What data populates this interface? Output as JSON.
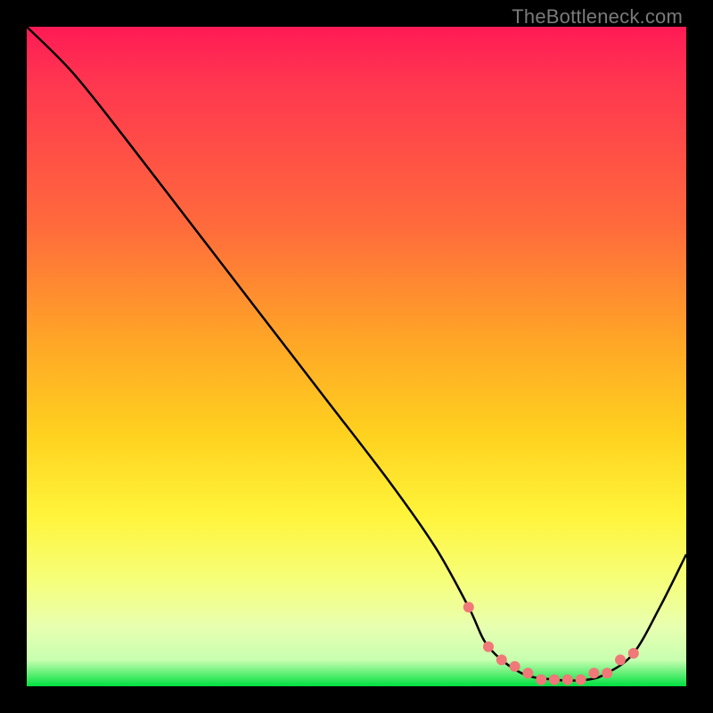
{
  "watermark": "TheBottleneck.com",
  "colors": {
    "bg": "#000000",
    "gradient_top": "#ff1a55",
    "gradient_bottom": "#00e040",
    "curve": "#000000",
    "dots": "#f07878"
  },
  "chart_data": {
    "type": "line",
    "title": "",
    "xlabel": "",
    "ylabel": "",
    "xlim": [
      0,
      100
    ],
    "ylim": [
      0,
      100
    ],
    "series": [
      {
        "name": "curve",
        "x": [
          0,
          7,
          15,
          25,
          35,
          45,
          55,
          62,
          67,
          70,
          75,
          80,
          85,
          88,
          92,
          96,
          100
        ],
        "y": [
          100,
          93,
          83,
          70,
          57,
          44,
          31,
          21,
          12,
          6,
          2,
          1,
          1,
          2,
          5,
          12,
          20
        ]
      }
    ],
    "markers": {
      "name": "dots",
      "x": [
        67,
        70,
        72,
        74,
        76,
        78,
        80,
        82,
        84,
        86,
        88,
        90,
        92
      ],
      "y": [
        12,
        6,
        4,
        3,
        2,
        1,
        1,
        1,
        1,
        2,
        2,
        4,
        5
      ]
    }
  }
}
